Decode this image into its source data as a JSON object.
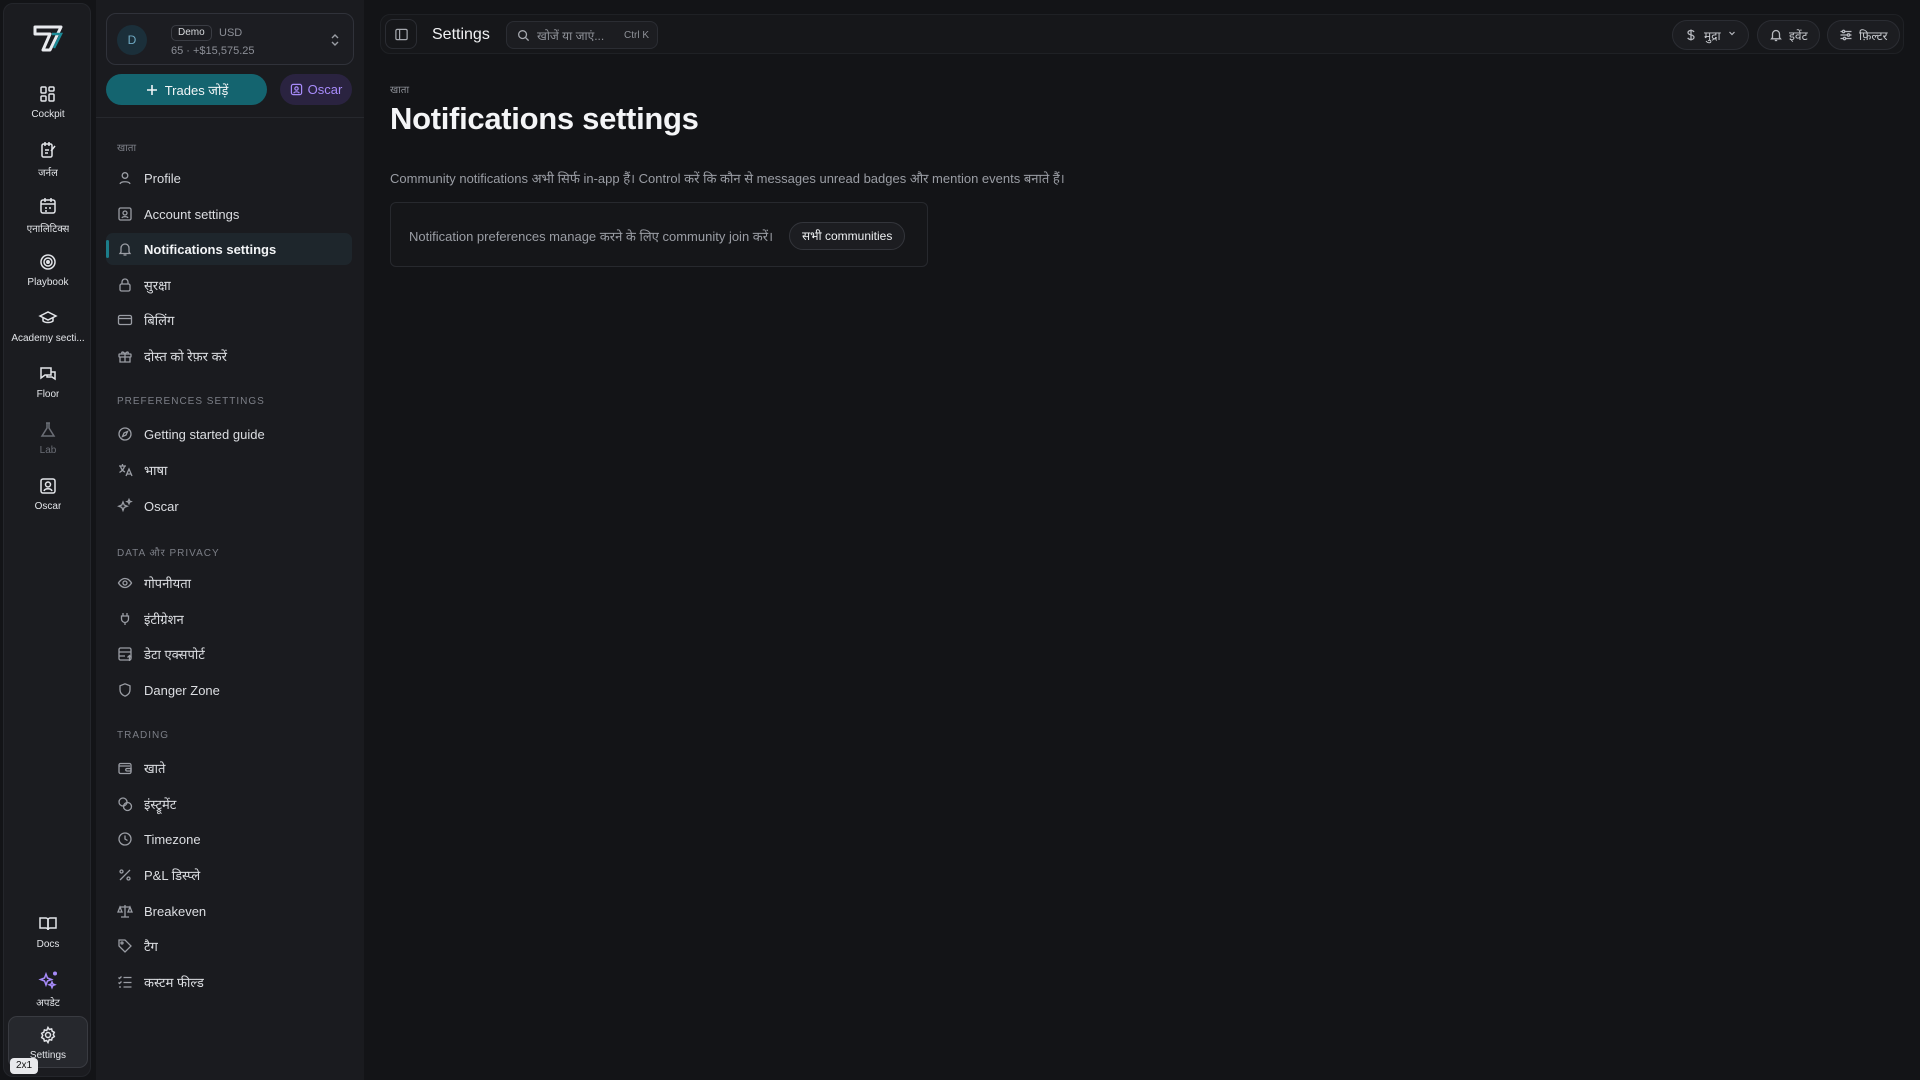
{
  "rail": {
    "items": [
      {
        "label": "Cockpit",
        "icon": "cockpit-icon"
      },
      {
        "label": "जर्नल",
        "icon": "journal-icon"
      },
      {
        "label": "एनालिटिक्स",
        "icon": "analytics-icon"
      },
      {
        "label": "Playbook",
        "icon": "playbook-icon"
      },
      {
        "label": "Academy secti...",
        "icon": "academy-icon"
      },
      {
        "label": "Floor",
        "icon": "floor-icon"
      },
      {
        "label": "Lab",
        "icon": "lab-icon"
      },
      {
        "label": "Oscar",
        "icon": "oscar-icon"
      }
    ],
    "bottom": [
      {
        "label": "Docs",
        "icon": "docs-icon"
      },
      {
        "label": "अपडेट",
        "icon": "updates-icon"
      },
      {
        "label": "Settings",
        "icon": "settings-icon"
      }
    ],
    "badge": "2x1"
  },
  "account": {
    "avatar": "D",
    "tag": "Demo",
    "currency": "USD",
    "sub": "65 · +$15,575.25"
  },
  "actions": {
    "add_trades": "Trades जोड़ें",
    "oscar": "Oscar"
  },
  "sidebar": {
    "sections": [
      {
        "title": "खाता",
        "items": [
          "Profile",
          "Account settings",
          "Notifications settings",
          "सुरक्षा",
          "बिलिंग",
          "दोस्त को रेफ़र करें"
        ]
      },
      {
        "title": "Preferences settings",
        "items": [
          "Getting started guide",
          "भाषा",
          "Oscar"
        ]
      },
      {
        "title": "Data और Privacy",
        "items": [
          "गोपनीयता",
          "इंटीग्रेशन",
          "डेटा एक्सपोर्ट",
          "Danger Zone"
        ]
      },
      {
        "title": "Trading",
        "items": [
          "खाते",
          "इंस्ट्रूमेंट",
          "Timezone",
          "P&L डिस्प्ले",
          "Breakeven",
          "टैग",
          "कस्टम फील्ड"
        ]
      }
    ],
    "active": "Notifications settings"
  },
  "topbar": {
    "title": "Settings",
    "search_placeholder": "खोजें या जाएं...",
    "search_shortcut": "Ctrl K",
    "currency_label": "मुद्रा",
    "events_label": "इवेंट",
    "filter_label": "फ़िल्टर"
  },
  "main": {
    "breadcrumb": "खाता",
    "title": "Notifications settings",
    "description": "Community notifications अभी सिर्फ in-app हैं। Control करें कि कौन से messages unread badges और mention events बनाते हैं।",
    "card_text": "Notification preferences manage करने के लिए community join करें।",
    "card_button": "सभी communities"
  },
  "colors": {
    "accent": "#14646f",
    "oscar": "#a78bfa",
    "background": "#131417"
  }
}
